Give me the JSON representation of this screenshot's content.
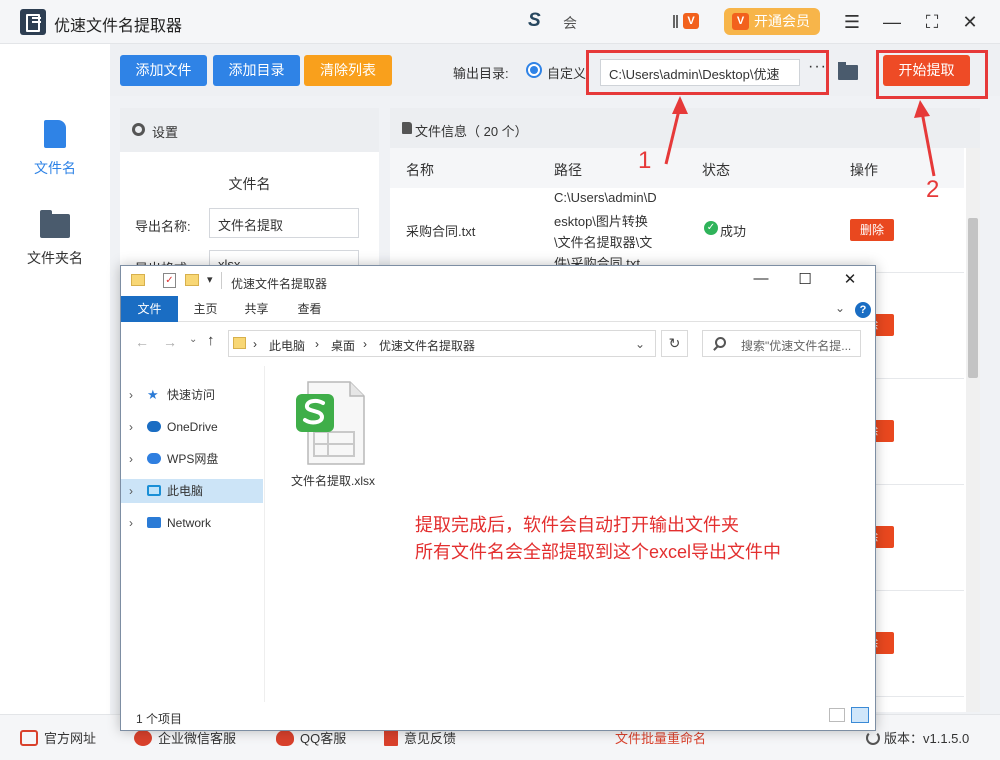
{
  "app": {
    "title": "优速文件名提取器",
    "brand_glyph": "S",
    "brand_text": "会",
    "vip_label": "开通会员",
    "vip_badge": "V"
  },
  "leftnav": {
    "items": [
      {
        "label": "文件名",
        "active": true
      },
      {
        "label": "文件夹名",
        "active": false
      }
    ]
  },
  "toolbar": {
    "add_file": "添加文件",
    "add_dir": "添加目录",
    "clear_list": "清除列表",
    "output_label": "输出目录:",
    "radio_label": "自定义",
    "path_value": "C:\\Users\\admin\\Desktop\\优速",
    "more": "···",
    "start": "开始提取"
  },
  "annotations": {
    "one": "1",
    "two": "2"
  },
  "settings": {
    "header": "设置",
    "section_title": "文件名",
    "export_name_label": "导出名称:",
    "export_name_value": "文件名提取",
    "export_format_label": "导出格式:",
    "export_format_value": "xlsx"
  },
  "file_panel": {
    "header": "文件信息（ 20 个）",
    "columns": [
      "名称",
      "路径",
      "状态",
      "操作"
    ],
    "rows": [
      {
        "name": "采购合同.txt",
        "path_lines": [
          "C:\\Users\\admin\\D",
          "esktop\\图片转换",
          "\\文件名提取器\\文",
          "件\\采购合同.txt"
        ],
        "status": "成功",
        "action": "删除"
      }
    ],
    "partial_delete": "除"
  },
  "footer": {
    "website": "官方网址",
    "wechat": "企业微信客服",
    "qq": "QQ客服",
    "feedback": "意见反馈",
    "rename": "文件批量重命名",
    "version": "版本：v1.1.5.0"
  },
  "explorer": {
    "title": "优速文件名提取器",
    "tabs": [
      "文件",
      "主页",
      "共享",
      "查看"
    ],
    "breadcrumb": [
      "此电脑",
      "桌面",
      "优速文件名提取器"
    ],
    "search_placeholder": "搜索\"优速文件名提...",
    "nav": [
      "快速访问",
      "OneDrive",
      "WPS网盘",
      "此电脑",
      "Network"
    ],
    "file_name": "文件名提取.xlsx",
    "note_line1": "提取完成后，软件会自动打开输出文件夹",
    "note_line2": "所有文件名会全部提取到这个excel导出文件中",
    "status_count": "1 个项目"
  },
  "colors": {
    "accent_blue": "#2f83e6",
    "orange": "#f9a01c",
    "start_red": "#ee4b26",
    "annotation_red": "#e63939",
    "vip_gold": "#f7b54a"
  }
}
